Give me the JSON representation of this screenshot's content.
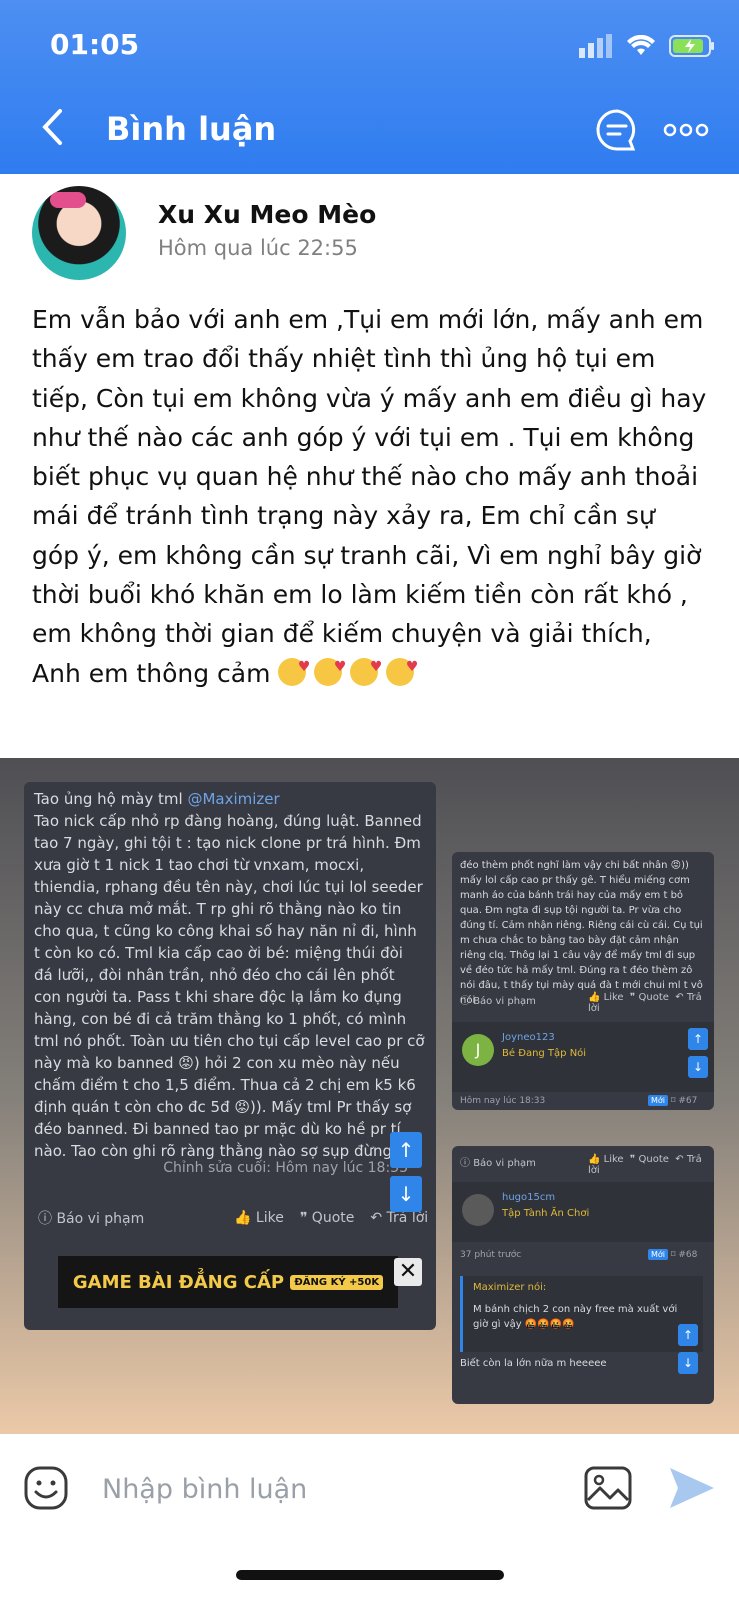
{
  "status": {
    "time": "01:05"
  },
  "nav": {
    "title": "Bình luận"
  },
  "post": {
    "author": "Xu Xu Meo Mèo",
    "time": "Hôm qua lúc 22:55",
    "text": "Em vẫn bảo với anh em ,Tụi em mới lớn, mấy anh em thấy em trao đổi thấy nhiệt tình thì ủng hộ tụi em tiếp, Còn tụi em không vừa ý mấy anh em điều gì hay như thế nào các anh góp ý với tụi em . Tụi em không biết phục vụ quan hệ như thế nào cho mấy anh thoải mái để tránh tình trạng này xảy ra, Em chỉ cần sự góp ý, em không cần sự tranh cãi, Vì em nghỉ bây giờ thời buổi khó khăn em lo làm kiếm tiền còn rất khó , em không thời gian để kiếm chuyện và giải thích, Anh em thông cảm"
  },
  "shot_left": {
    "line1": "Tao ủng hộ mày tml ",
    "mention": "@Maximizer",
    "body": "Tao nick cấp nhỏ rp đàng hoàng, đúng luật. Banned tao 7 ngày, ghi tội t : tạo nick clone pr trá hình. Đm xưa giờ t 1 nick 1 tao chơi từ vnxam, mocxi, thiendia, rphang đều tên này, chơi lúc tụi lol seeder này cc chưa mở mắt. T rp ghi rõ thằng nào ko tin cho qua, t cũng ko công khai số hay năn nỉ đi, hình t còn ko có. Tml kia cấp cao ời bé: miệng thúi đòi đá lưỡi,, đòi nhân trần, nhỏ đéo cho cái lên phốt con người ta. Pass t khi share độc lạ lắm ko đụng hàng, con bé đi cả trăm thằng ko 1 phốt, có mình tml nó phốt. Toàn ưu tiên cho tụi cấp level cao pr cỡ này mà ko banned 😡) hỏi 2 con xu mèo này nếu chấm điểm t cho 1,5 điểm. Thua cả 2 chị em k5 k6 định quán t còn cho đc 5đ 😡)). Mấy tml Pr thấy sợ đéo banned. Đi banned tao pr mặc dù ko hề pr tí nào. Tao còn ghi rõ ràng thằng nào sợ sụp đừng đi",
    "edited": "Chỉnh sửa cuối: Hôm nay lúc 18:33",
    "report": "Báo vi phạm",
    "like": "Like",
    "quote": "Quote",
    "reply": "Trả lời",
    "ad_text": "GAME BÀI ĐẲNG CẤP",
    "ad_badge": "ĐĂNG KÝ +50K"
  },
  "shot_tr": {
    "body": "đéo thèm phốt nghĩ làm vậy chi bất nhân 😡)) mấy lol cấp cao pr thấy gê. T hiểu miếng cơm manh áo của bánh trái hay của mấy em t bỏ qua. Đm ngta đi sụp tội người ta. Pr vừa cho đúng tí. Cảm nhận riêng. Riêng cái cù cái. Cụ tụi m chưa chắc to bằng tao bày đặt cảm nhận riêng clq. Thôg lại 1 câu vậy để mấy tml đi sụp về đéo tức hả mấy tml. Đúng ra t đéo thèm zô nói đâu, t thấy tụi mày quá đà t mới chui ml t vô nói",
    "report": "Báo vi phạm",
    "like": "Like",
    "quote": "Quote",
    "reply": "Trả lời",
    "user": "Joyneo123",
    "role": "Bé Đang Tập Nói",
    "time": "Hôm nay lúc 18:33",
    "new": "Mới",
    "num": "#67"
  },
  "shot_br": {
    "report": "Báo vi phạm",
    "like": "Like",
    "quote": "Quote",
    "reply": "Trả lời",
    "user": "hugo15cm",
    "role": "Tập Tành Ăn Chơi",
    "time": "37 phút trước",
    "new": "Mới",
    "num": "#68",
    "quote_title": "Maximizer nói:",
    "quote_text": "M bánh chịch 2 con này free mà xuất với giờ gì vậy 🤬🤬🤬🤬",
    "reply_text": "Biết còn la lớn nữa m heeeee"
  },
  "composer": {
    "placeholder": "Nhập bình luận"
  }
}
